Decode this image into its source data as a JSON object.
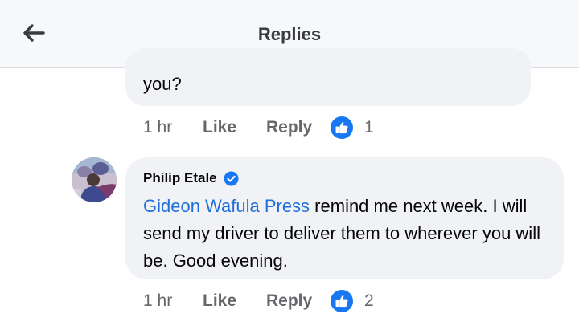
{
  "header": {
    "title": "Replies",
    "back_icon": "arrow-left-icon"
  },
  "previous_comment": {
    "text_tail": "you?",
    "time": "1 hr",
    "like_label": "Like",
    "reply_label": "Reply",
    "reaction_icon": "thumbs-up-icon",
    "reaction_count": "1"
  },
  "reply": {
    "author": "Philip Etale",
    "verified_icon": "verified-badge-icon",
    "mention": "Gideon Wafula Press",
    "text": " remind me next week. I will send my driver to deliver them to wherever you will be. Good evening.",
    "time": "1 hr",
    "like_label": "Like",
    "reply_label": "Reply",
    "reaction_icon": "thumbs-up-icon",
    "reaction_count": "2"
  },
  "colors": {
    "accent": "#1877f2",
    "mention": "#216fdb",
    "bubble": "#f0f2f5",
    "meta_text": "#65676b"
  }
}
